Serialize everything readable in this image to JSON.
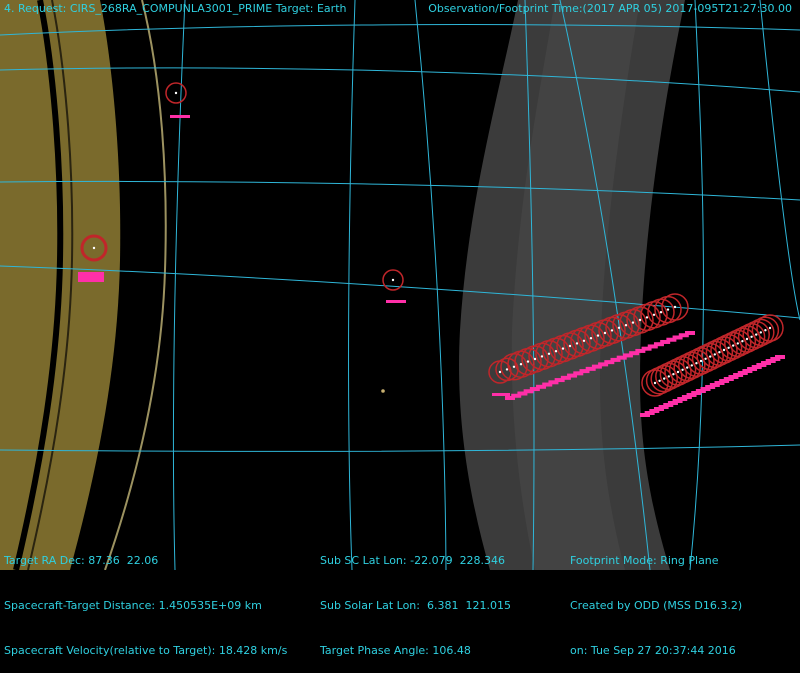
{
  "header": {
    "request": "4. Request: CIRS_268RA_COMPUNLA3001_PRIME Target: Earth",
    "observation_time": "Observation/Footprint Time:(2017 APR 05) 2017-095T21:27:30.00"
  },
  "info": {
    "col1": [
      "Target RA Dec: 87.36  22.06",
      "Spacecraft-Target Distance: 1.450535E+09 km",
      "Spacecraft Velocity(relative to Target): 18.428 km/s"
    ],
    "col2": [
      "Sub SC Lat Lon: -22.079  228.346",
      "Sub Solar Lat Lon:  6.381  121.015",
      "Target Phase Angle: 106.48"
    ],
    "col3": [
      "Footprint Mode: Ring Plane",
      "Created by ODD (MSS D16.3.2)",
      "on: Tue Sep 27 20:37:44 2016"
    ]
  },
  "colors": {
    "grid": "#2fb6d8",
    "ring_left": "#7a6a2c",
    "ring_right": "#3c3c3c",
    "footprint_circle": "#c0262a",
    "footprint_pink": "#ff2fa8",
    "hud_text": "#2fd0e0"
  }
}
